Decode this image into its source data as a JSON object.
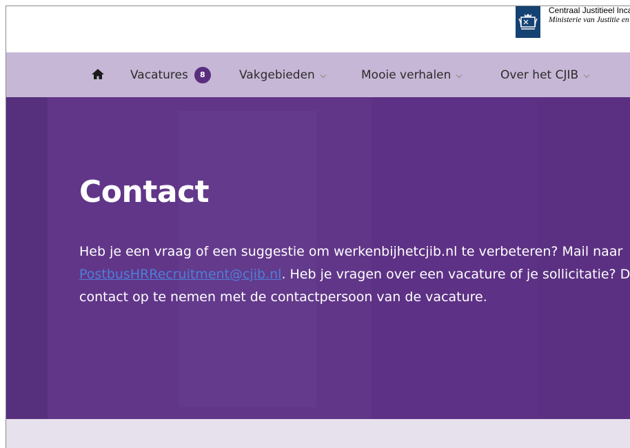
{
  "header": {
    "org_name": "Centraal Justitieel Incassobureau",
    "ministry": "Ministerie van Justitie en Veiligheid"
  },
  "nav": {
    "home_icon": "home-icon",
    "items": [
      {
        "label": "Vacatures",
        "badge": "8"
      },
      {
        "label": "Vakgebieden"
      },
      {
        "label": "Mooie verhalen"
      },
      {
        "label": "Over het CJIB"
      }
    ]
  },
  "hero": {
    "title": "Contact",
    "line1": "Heb je een vraag of een suggestie om werkenbijhetcjib.nl te verbeteren? Mail naar",
    "link": "PostbusHRRecruitment@cjib.nl",
    "line2_rest": ". Heb je vragen over een vacature of je sollicitatie? Dan vragen we je",
    "line3": "contact op te nemen met de contactpersoon van de vacature."
  },
  "colors": {
    "nav_bg": "#c7b7d6",
    "hero_bg": "#5d3285",
    "badge_bg": "#5a2d7e",
    "logo_bg": "#154273",
    "link": "#4d7fd9"
  }
}
